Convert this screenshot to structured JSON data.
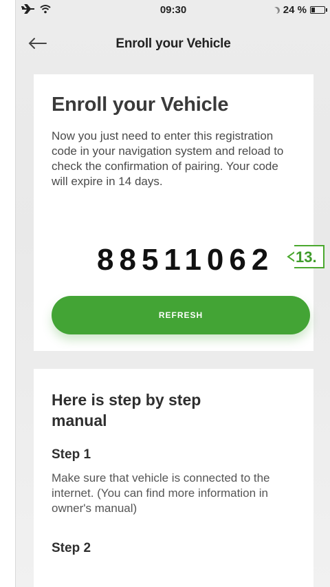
{
  "status_bar": {
    "time": "09:30",
    "battery_percent": "24 %",
    "battery_level": 0.24
  },
  "nav": {
    "title": "Enroll your Vehicle"
  },
  "enroll_card": {
    "title": "Enroll your Vehicle",
    "description": "Now you just need to enter this registration code in your navigation system and reload to check the confirmation of pairing. Your code will expire in 14 days.",
    "code": "88511062",
    "refresh_label": "REFRESH"
  },
  "callout": {
    "label": "13."
  },
  "steps_card": {
    "title": "Here is step by step manual",
    "steps": [
      {
        "heading": "Step 1",
        "text": "Make sure that vehicle is connected to the internet. (You can find more information in owner's manual)"
      },
      {
        "heading": "Step 2",
        "text": ""
      }
    ]
  },
  "colors": {
    "accent_green": "#43a435",
    "callout_green": "#4aa82e"
  }
}
